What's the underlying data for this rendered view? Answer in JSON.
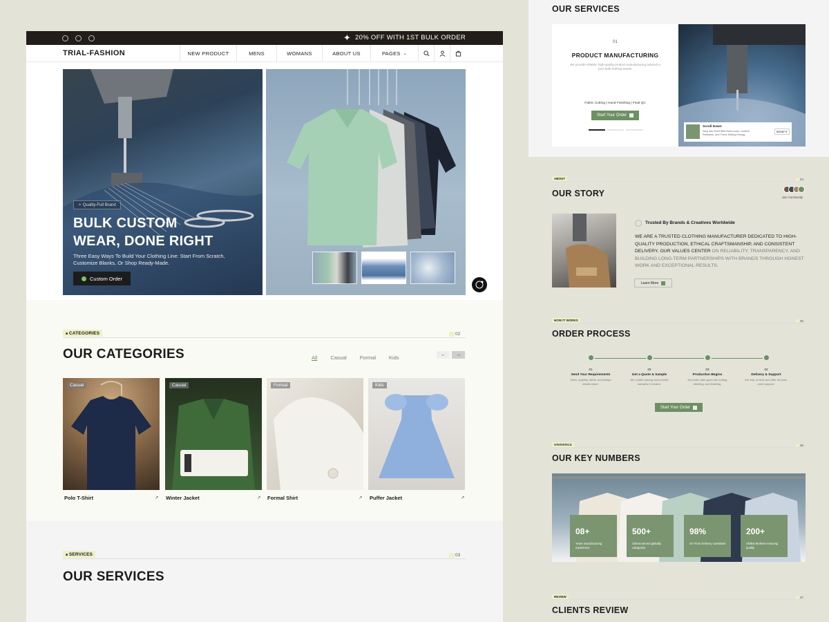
{
  "topbar": {
    "promo": "20% OFF WITH 1ST BULK ORDER"
  },
  "nav": {
    "logo": "TRIAL-FASHION",
    "items": [
      "NEW PRODUCT",
      "MENS",
      "WOMANS",
      "ABOUT US",
      "PAGES"
    ]
  },
  "hero": {
    "badge": "Quality-Full Brand",
    "title_line1": "BULK CUSTOM",
    "title_line2": "WEAR, DONE RIGHT",
    "subtitle": "Three Easy Ways To Build Your Clothing Line: Start From Scratch, Customize Blanks, Or Shop Ready-Made.",
    "cta": "Custom Order"
  },
  "categories": {
    "tag": "CATEGORIES",
    "num": "02",
    "title": "OUR CATEGORIES",
    "filters": [
      "All",
      "Casual",
      "Formal",
      "Kids"
    ],
    "cards": [
      {
        "tag": "Casual",
        "name": "Polo T-Shirt"
      },
      {
        "tag": "Casual",
        "name": "Winter Jacket"
      },
      {
        "tag": "Formal",
        "name": "Formal Shirt"
      },
      {
        "tag": "Kids",
        "name": "Puffer Jacket"
      }
    ],
    "card_arrow": "↗"
  },
  "services_left": {
    "tag": "SERVICES",
    "num": "03",
    "title": "OUR SERVICES"
  },
  "services_right": {
    "title": "OUR SERVICES",
    "num": "01",
    "card_title": "PRODUCT MANUFACTURING",
    "card_desc": "We provide reliable, high-quality product manufacturing tailored to your bulk clothing needs.",
    "features": "Fabric Cutting | Hand Finishing | Final QC",
    "cta": "Start Your Order",
    "scroll_title": "Scroll Down",
    "scroll_desc": "Step Into 2026 With Bold Looks, Limited Releases, And Trend-Setting Energy.",
    "scroll_btn": "BENEFIT"
  },
  "story": {
    "tag": "ABOUT",
    "num": "04",
    "title": "OUR STORY",
    "community": "Join Community",
    "trusted": "Trusted By Brands & Creatives Worldwide",
    "body_dark": "WE ARE A TRUSTED CLOTHING MANUFACTURER DEDICATED TO HIGH-QUALITY PRODUCTION, ETHICAL CRAFTSMANSHIP, AND CONSISTENT DELIVERY. OUR VALUES CENTER",
    "body_light": " ON RELIABILITY, TRANSPARENCY, AND BUILDING LONG-TERM PARTNERSHIPS WITH BRANDS THROUGH HONEST WORK AND EXCEPTIONAL RESULTS.",
    "cta": "Learn More"
  },
  "process": {
    "tag": "HOW IT WORKS",
    "num": "05",
    "title": "ORDER PROCESS",
    "steps": [
      {
        "num": "01",
        "title": "Send Your Requirements",
        "desc": "Sizes, quantity, fabric, and design details share."
      },
      {
        "num": "02",
        "title": "Get a Quote & Sample",
        "desc": "We confirm pricing and provide samples if needed."
      },
      {
        "num": "03",
        "title": "Production Begins",
        "desc": "Your bulk order goes into cutting, stitching, and finishing."
      },
      {
        "num": "04",
        "title": "Delivery & Support",
        "desc": "We ship on time and offer full post-order support."
      }
    ],
    "cta": "Start Your Order"
  },
  "numbers": {
    "tag": "STATISTICS",
    "num": "06",
    "title": "OUR KEY NUMBERS",
    "items": [
      {
        "value": "08+",
        "label": "Years manufacturing experience"
      },
      {
        "value": "500+",
        "label": "Clients served globally categories"
      },
      {
        "value": "98%",
        "label": "On-Time Delivery consistent"
      },
      {
        "value": "200+",
        "label": "Skilled Workers ensuring quality"
      }
    ]
  },
  "review": {
    "tag": "REVIEW",
    "num": "07",
    "title": "CLIENTS REVIEW"
  },
  "colors": {
    "accent": "#6e8f63",
    "dark": "#221d18",
    "tag_bg": "#eef0c6"
  }
}
